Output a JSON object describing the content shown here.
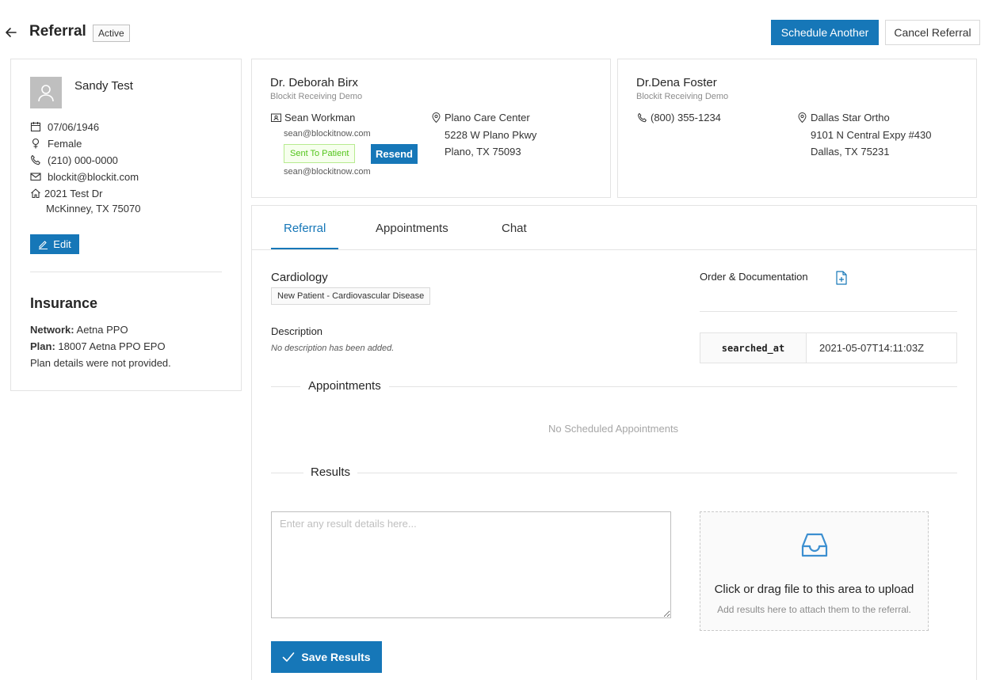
{
  "header": {
    "title": "Referral",
    "status": "Active",
    "schedule_label": "Schedule Another",
    "cancel_label": "Cancel Referral"
  },
  "patient": {
    "name": "Sandy Test",
    "dob": "07/06/1946",
    "gender": "Female",
    "phone": "(210) 000-0000",
    "email": "blockit@blockit.com",
    "address_line1": "2021 Test Dr",
    "address_line2": "McKinney, TX 75070",
    "edit_label": "Edit",
    "insurance": {
      "title": "Insurance",
      "network_label": "Network:",
      "network": "Aetna PPO",
      "plan_label": "Plan:",
      "plan": "18007 Aetna PPO EPO",
      "plan_note": "Plan details were not provided."
    }
  },
  "referring_provider": {
    "name": "Dr. Deborah Birx",
    "org": "Blockit Receiving Demo",
    "contact_name": "Sean Workman",
    "contact_email": "sean@blockitnow.com",
    "sent_tag": "Sent To Patient",
    "resend_label": "Resend",
    "contact_email_2": "sean@blockitnow.com",
    "location_name": "Plano Care Center",
    "location_street": "5228 W Plano Pkwy",
    "location_city": "Plano, TX 75093"
  },
  "receiving_provider": {
    "name": "Dr.Dena Foster",
    "org": "Blockit Receiving Demo",
    "phone": "(800) 355-1234",
    "location_name": "Dallas Star Ortho",
    "location_street": "9101 N Central Expy #430",
    "location_city": "Dallas, TX 75231"
  },
  "tabs": [
    {
      "label": "Referral",
      "active": true
    },
    {
      "label": "Appointments",
      "active": false
    },
    {
      "label": "Chat",
      "active": false
    }
  ],
  "referral": {
    "specialty": "Cardiology",
    "visit_type": "New Patient - Cardiovascular Disease",
    "description_label": "Description",
    "description_empty": "No description has been added.",
    "order_label": "Order & Documentation",
    "meta_key": "searched_at",
    "meta_value": "2021-05-07T14:11:03Z",
    "appointments_label": "Appointments",
    "no_appointments": "No Scheduled Appointments",
    "results_label": "Results",
    "results_placeholder": "Enter any result details here...",
    "upload_text": "Click or drag file to this area to upload",
    "upload_hint": "Add results here to attach them to the referral.",
    "save_label": "Save Results"
  },
  "colors": {
    "primary": "#1677b8",
    "success": "#52c41a",
    "border": "#e3e3e3"
  }
}
